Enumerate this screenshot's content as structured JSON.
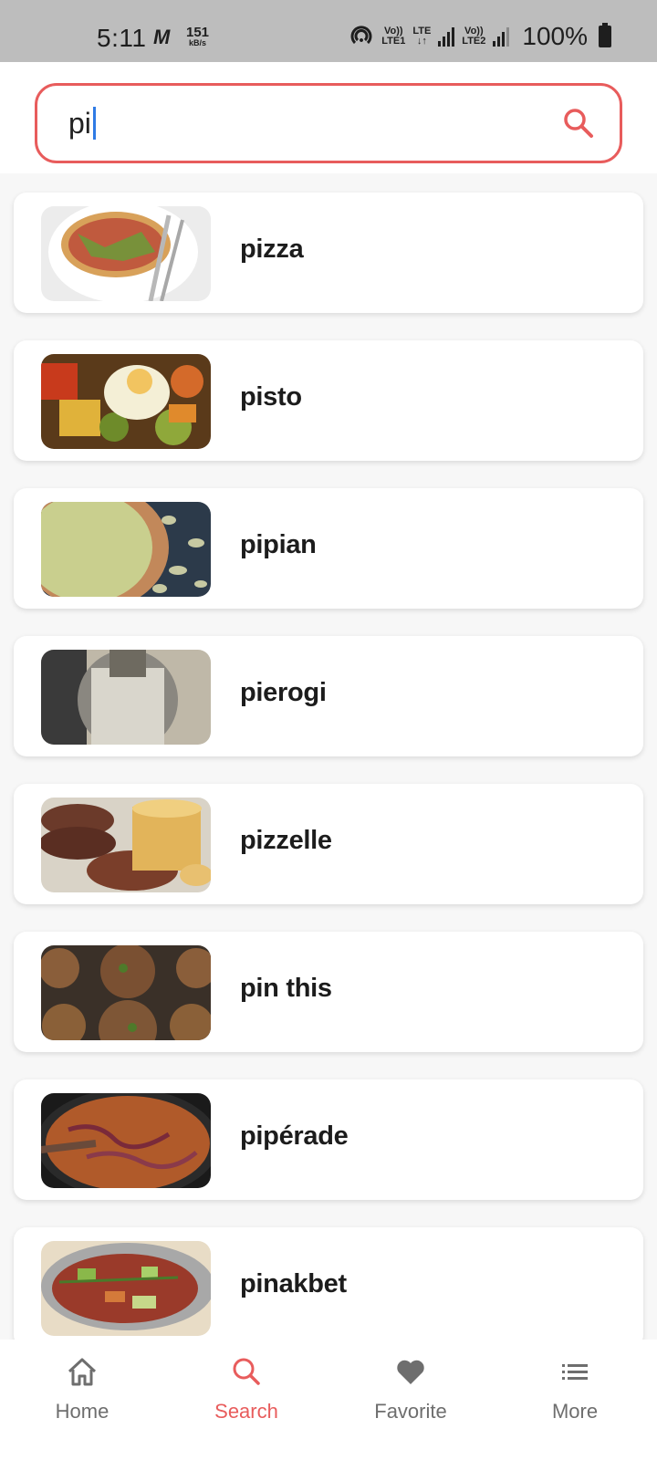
{
  "status_bar": {
    "time": "5:11",
    "carrier_icon": "M",
    "speed_value": "151",
    "speed_unit": "kB/s",
    "sim1_label_top": "Vo))",
    "sim1_label_bottom": "LTE1",
    "lte_label_top": "LTE",
    "lte_label_bottom": "↓↑",
    "sim2_label_top": "Vo))",
    "sim2_label_bottom": "LTE2",
    "battery": "100%"
  },
  "search": {
    "value": "pi",
    "icon": "search-icon",
    "accent_color": "#e85c5c"
  },
  "results": [
    {
      "title": "pizza",
      "image": "pizza-photo"
    },
    {
      "title": "pisto",
      "image": "pisto-photo"
    },
    {
      "title": "pipian",
      "image": "pipian-photo"
    },
    {
      "title": "pierogi",
      "image": "pierogi-photo"
    },
    {
      "title": "pizzelle",
      "image": "pizzelle-photo"
    },
    {
      "title": "pin this",
      "image": "pin-this-photo"
    },
    {
      "title": "pipérade",
      "image": "piperade-photo"
    },
    {
      "title": "pinakbet",
      "image": "pinakbet-photo"
    }
  ],
  "bottom_nav": {
    "items": [
      {
        "label": "Home",
        "icon": "home-icon",
        "active": false
      },
      {
        "label": "Search",
        "icon": "search-icon",
        "active": true
      },
      {
        "label": "Favorite",
        "icon": "heart-icon",
        "active": false
      },
      {
        "label": "More",
        "icon": "list-icon",
        "active": false
      }
    ]
  }
}
